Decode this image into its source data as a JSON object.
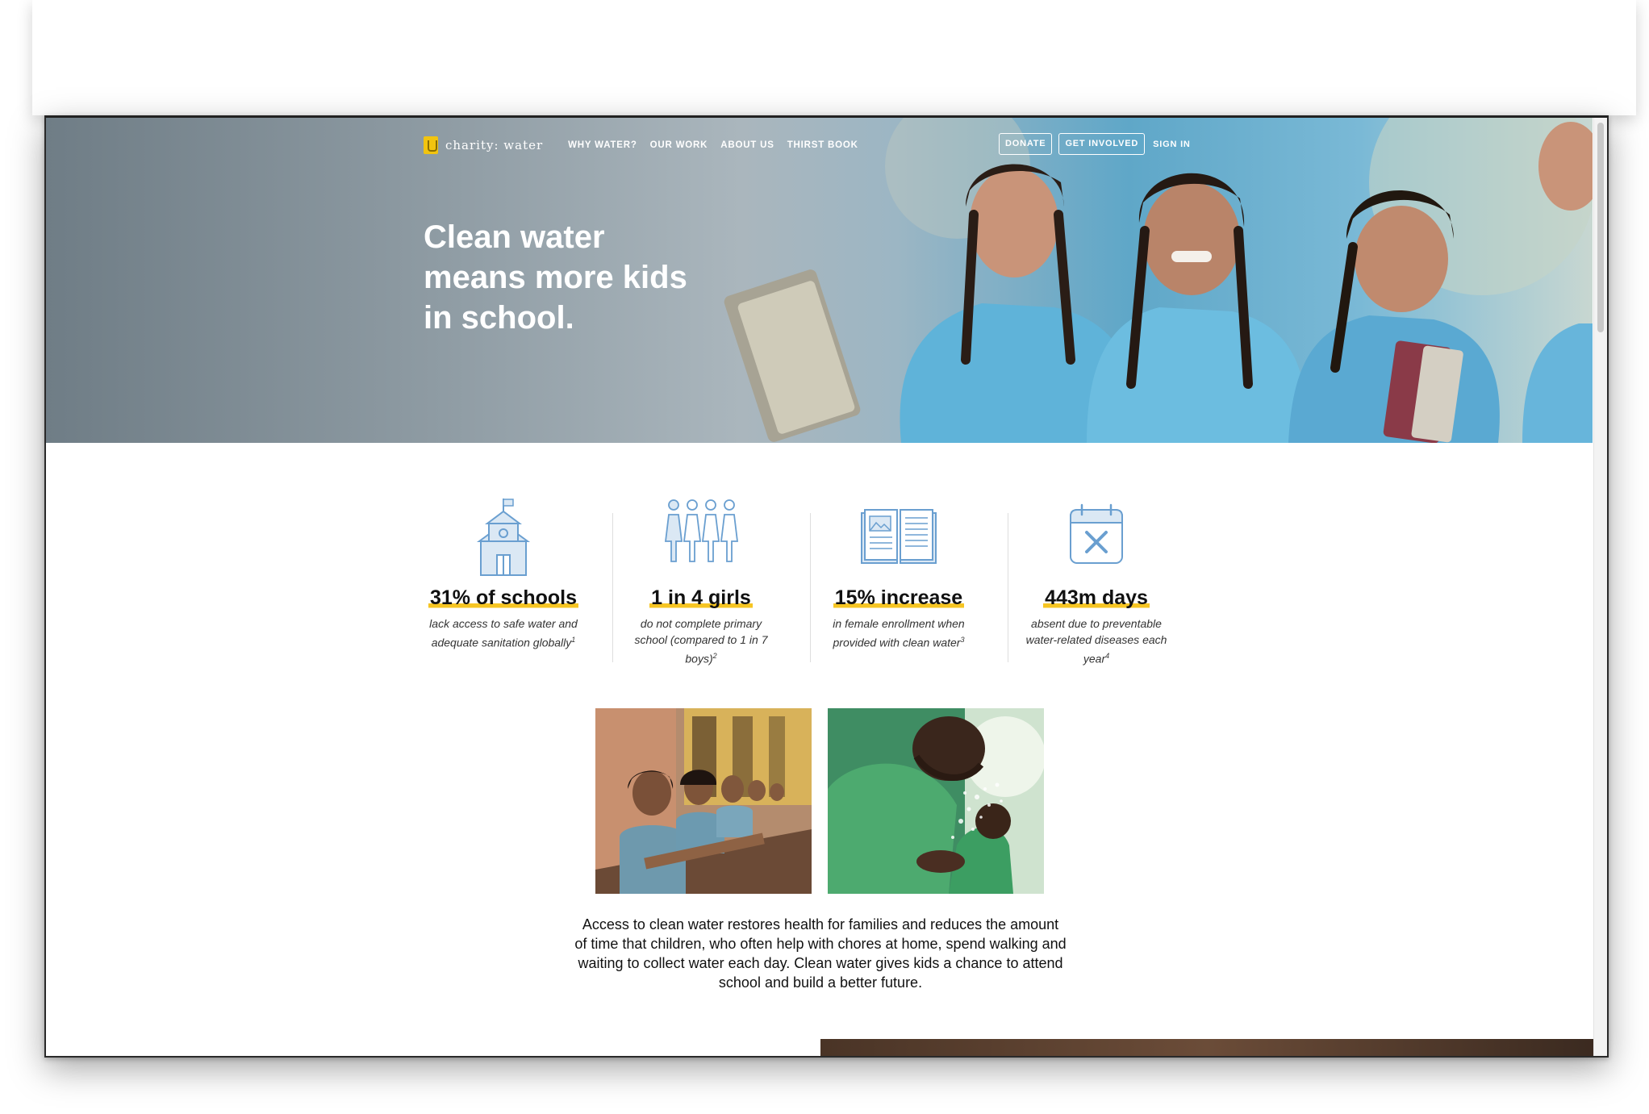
{
  "nav": {
    "logo_text": "charity: water",
    "links": [
      "WHY WATER?",
      "OUR WORK",
      "ABOUT US",
      "THIRST BOOK"
    ],
    "donate_label": "DONATE",
    "get_involved_label": "GET INVOLVED",
    "sign_in_label": "SIGN IN"
  },
  "hero": {
    "title": "Clean water means more kids in school."
  },
  "stats": [
    {
      "value": "31% of schools",
      "desc": "lack access to safe water and adequate sanitation globally",
      "ref": "1",
      "icon": "schoolhouse-icon"
    },
    {
      "value": "1 in 4 girls",
      "desc": "do not complete primary school (compared to 1 in 7 boys)",
      "ref": "2",
      "icon": "girls-icon"
    },
    {
      "value": "15% increase",
      "desc": "in female enrollment when provided with clean water",
      "ref": "3",
      "icon": "open-book-icon"
    },
    {
      "value": "443m days",
      "desc": "absent due to preventable water-related diseases each year",
      "ref": "4",
      "icon": "calendar-x-icon"
    }
  ],
  "body_text": "Access to clean water restores health for families and reduces the amount of time that children, who often help with chores at home, spend walking and waiting to collect water each day. Clean water gives kids a chance to attend school and build a better future.",
  "colors": {
    "highlight": "#f6c523",
    "icon_stroke": "#6a9fd0",
    "icon_fill": "#dbe8f4",
    "logo_yellow": "#f2c40f"
  }
}
